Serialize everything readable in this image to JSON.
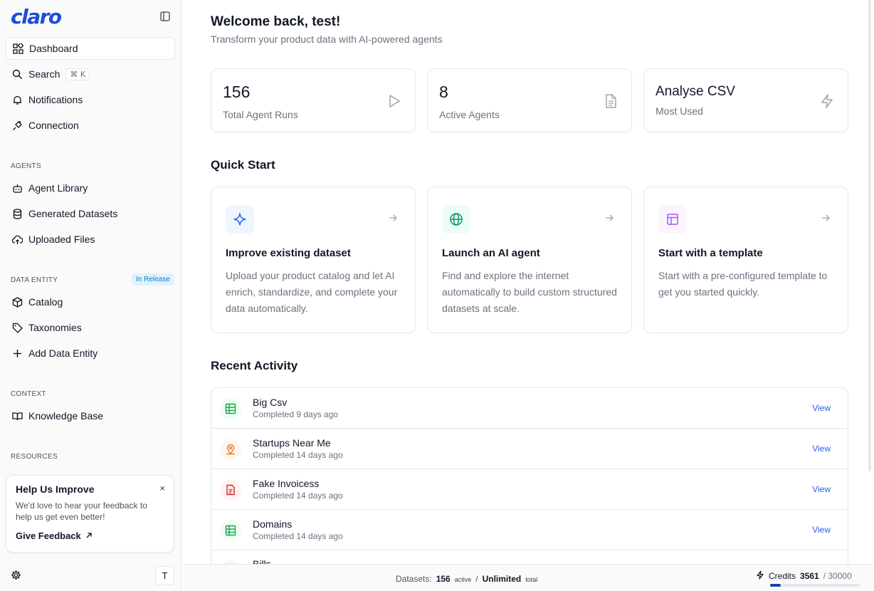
{
  "sidebar": {
    "logo": "claro",
    "nav": [
      {
        "label": "Dashboard"
      },
      {
        "label": "Search",
        "shortcut": "⌘ K"
      },
      {
        "label": "Notifications"
      },
      {
        "label": "Connection"
      }
    ],
    "agents_label": "AGENTS",
    "agents": [
      {
        "label": "Agent Library"
      },
      {
        "label": "Generated Datasets"
      },
      {
        "label": "Uploaded Files"
      }
    ],
    "data_entity_label": "DATA ENTITY",
    "data_entity_badge": "In Release",
    "data_entity": [
      {
        "label": "Catalog"
      },
      {
        "label": "Taxonomies"
      },
      {
        "label": "Add Data Entity"
      }
    ],
    "context_label": "CONTEXT",
    "context": [
      {
        "label": "Knowledge Base"
      }
    ],
    "resources_label": "RESOURCES",
    "feedback": {
      "title": "Help Us Improve",
      "close": "×",
      "text": "We'd love to hear your feedback to help us get even better!",
      "link": "Give Feedback"
    },
    "avatar": "T"
  },
  "main": {
    "welcome": "Welcome back, test!",
    "subtitle": "Transform your product data with AI-powered agents",
    "stats": [
      {
        "value": "156",
        "label": "Total Agent Runs",
        "icon": "play-icon"
      },
      {
        "value": "8",
        "label": "Active Agents",
        "icon": "document-icon"
      },
      {
        "value": "Analyse CSV",
        "label": "Most Used",
        "icon": "lightning-icon"
      }
    ],
    "quick_start_title": "Quick Start",
    "quick_start": [
      {
        "title": "Improve existing dataset",
        "desc": "Upload your product catalog and let AI enrich, standardize, and complete your data automatically.",
        "icon": "sparkle-icon"
      },
      {
        "title": "Launch an AI agent",
        "desc": "Find and explore the internet automatically to build custom structured datasets at scale.",
        "icon": "globe-icon"
      },
      {
        "title": "Start with a template",
        "desc": "Start with a pre-configured template to get you started quickly.",
        "icon": "template-icon"
      }
    ],
    "recent_title": "Recent Activity",
    "recent": [
      {
        "name": "Big Csv",
        "status": "Completed 9 days ago",
        "action": "View",
        "icon": "table-icon"
      },
      {
        "name": "Startups Near Me",
        "status": "Completed 14 days ago",
        "action": "View",
        "icon": "map-pin-icon"
      },
      {
        "name": "Fake Invoicess",
        "status": "Completed 14 days ago",
        "action": "View",
        "icon": "file-text-icon"
      },
      {
        "name": "Domains",
        "status": "Completed 14 days ago",
        "action": "View",
        "icon": "table-icon"
      },
      {
        "name": "Bills",
        "status": "",
        "action": "",
        "icon": "file-text-icon"
      }
    ]
  },
  "footer": {
    "datasets_label": "Datasets:",
    "datasets_active": "156",
    "active_word": "active",
    "separator": "/",
    "datasets_total": "Unlimited",
    "total_word": "total",
    "credits_label": "Credits",
    "credits_used": "3561",
    "credits_total": "/ 30000",
    "credits_fraction": 0.1187
  },
  "colors": {
    "accent": "#1d4ed8",
    "link": "#2563eb",
    "green": "#16a34a",
    "orange": "#f97316",
    "red": "#dc2626",
    "purple": "#a855f7"
  }
}
